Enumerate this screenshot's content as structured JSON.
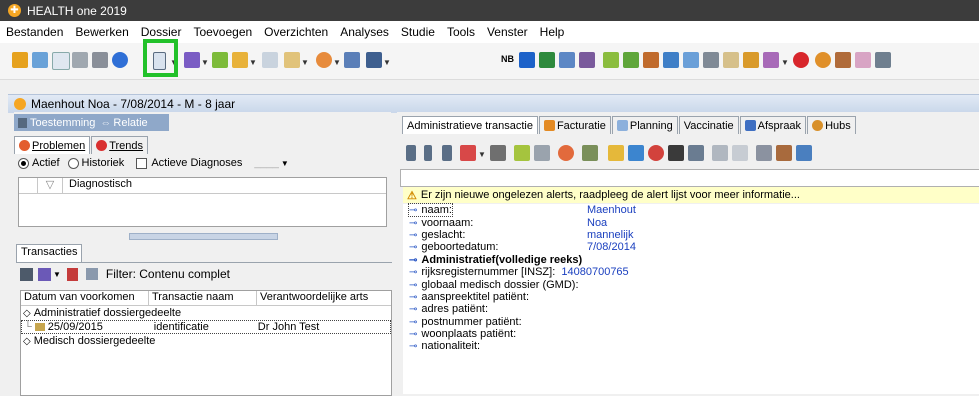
{
  "window": {
    "title": "HEALTH one 2019"
  },
  "menu": [
    "Bestanden",
    "Bewerken",
    "Dossier",
    "Toevoegen",
    "Overzichten",
    "Analyses",
    "Studie",
    "Tools",
    "Venster",
    "Help"
  ],
  "toolbar": {
    "nb_label": "NB"
  },
  "patient": {
    "header": "Maenhout Noa - 7/08/2014 - M - 8 jaar"
  },
  "left": {
    "toestemming": "Toestemming",
    "relatie": "Relatie",
    "tab_problemen": "Problemen",
    "tab_trends": "Trends",
    "radio_actief": "Actief",
    "radio_historiek": "Historiek",
    "check_actieve": "Actieve Diagnoses",
    "diag_column": "Diagnostisch",
    "trans_tab": "Transacties",
    "filter": "Filter: Contenu complet",
    "columns": [
      "Datum van voorkomen",
      "Transactie naam",
      "Verantwoordelijke arts"
    ],
    "group_admin": "Administratief dossiergedeelte",
    "row_date": "25/09/2015",
    "row_name": "identificatie",
    "row_doc": "Dr John Test",
    "group_medisch": "Medisch dossiergedeelte"
  },
  "right": {
    "tabs": [
      "Administratieve transactie",
      "Facturatie",
      "Planning",
      "Vaccinatie",
      "Afspraak",
      "Hubs"
    ],
    "alert": "Er zijn nieuwe ongelezen alerts, raadpleeg de alert lijst voor meer informatie...",
    "fields": [
      {
        "key": "naam:",
        "val": "Maenhout"
      },
      {
        "key": "voornaam:",
        "val": "Noa"
      },
      {
        "key": "geslacht:",
        "val": "mannelijk"
      },
      {
        "key": "geboortedatum:",
        "val": "7/08/2014"
      },
      {
        "key": "Administratief(volledige reeks)",
        "val": ""
      },
      {
        "key": "rijksregisternummer [INSZ]:",
        "val": "14080700765"
      },
      {
        "key": "globaal medisch dossier (GMD):",
        "val": ""
      },
      {
        "key": "aanspreektitel patiënt:",
        "val": ""
      },
      {
        "key": "adres patiënt:",
        "val": ""
      },
      {
        "key": "postnummer patiënt:",
        "val": ""
      },
      {
        "key": "woonplaats patiënt:",
        "val": ""
      },
      {
        "key": "nationaliteit:",
        "val": ""
      }
    ]
  }
}
